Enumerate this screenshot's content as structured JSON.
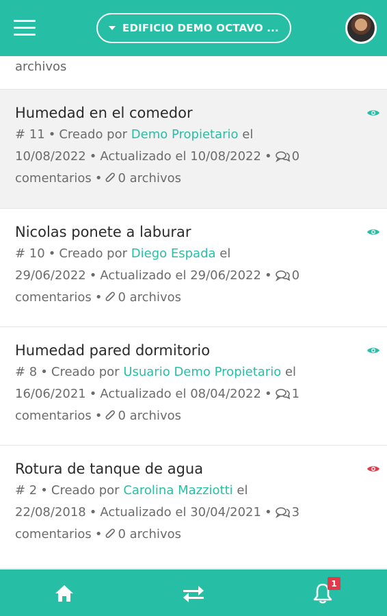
{
  "header": {
    "building_label": "EDIFICIO DEMO OCTAVO ...",
    "menu_icon": "hamburger-menu-icon",
    "avatar_icon": "user-avatar"
  },
  "partial_item": {
    "trailing_text": "archivos"
  },
  "items": [
    {
      "title": "Humedad en el comedor",
      "number": "# 11",
      "created_prefix": "Creado por",
      "author": "Demo Propietario",
      "created_date": "el 10/08/2022",
      "updated": "Actualizado el 10/08/2022",
      "comments": "0 comentarios",
      "files": "0 archivos",
      "status_color": "#26bfa6",
      "highlight": true
    },
    {
      "title": "Nicolas ponete a laburar",
      "number": "# 10",
      "created_prefix": "Creado por",
      "author": "Diego Espada",
      "created_date": "el 29/06/2022",
      "updated": "Actualizado el 29/06/2022",
      "comments": "0 comentarios",
      "files": "0 archivos",
      "status_color": "#26bfa6",
      "highlight": false
    },
    {
      "title": "Humedad pared dormitorio",
      "number": "# 8",
      "created_prefix": "Creado por",
      "author": "Usuario Demo Propietario",
      "created_date": "el 16/06/2021",
      "updated": "Actualizado el 08/04/2022",
      "comments": "1 comentarios",
      "files": "0 archivos",
      "status_color": "#26bfa6",
      "highlight": false
    },
    {
      "title": "Rotura de tanque de agua",
      "number": "# 2",
      "created_prefix": "Creado por",
      "author": "Carolina Mazziotti",
      "created_date": "el 22/08/2018",
      "updated": "Actualizado el 30/04/2021",
      "comments": "3 comentarios",
      "files": "0 archivos",
      "status_color": "#e03a4b",
      "highlight": false
    }
  ],
  "bottom_nav": {
    "home_icon": "home-icon",
    "transfer_icon": "transfer-arrows-icon",
    "bell_icon": "bell-icon",
    "notification_count": "1"
  },
  "colors": {
    "primary": "#26bfa6",
    "alert": "#e03a4b"
  }
}
